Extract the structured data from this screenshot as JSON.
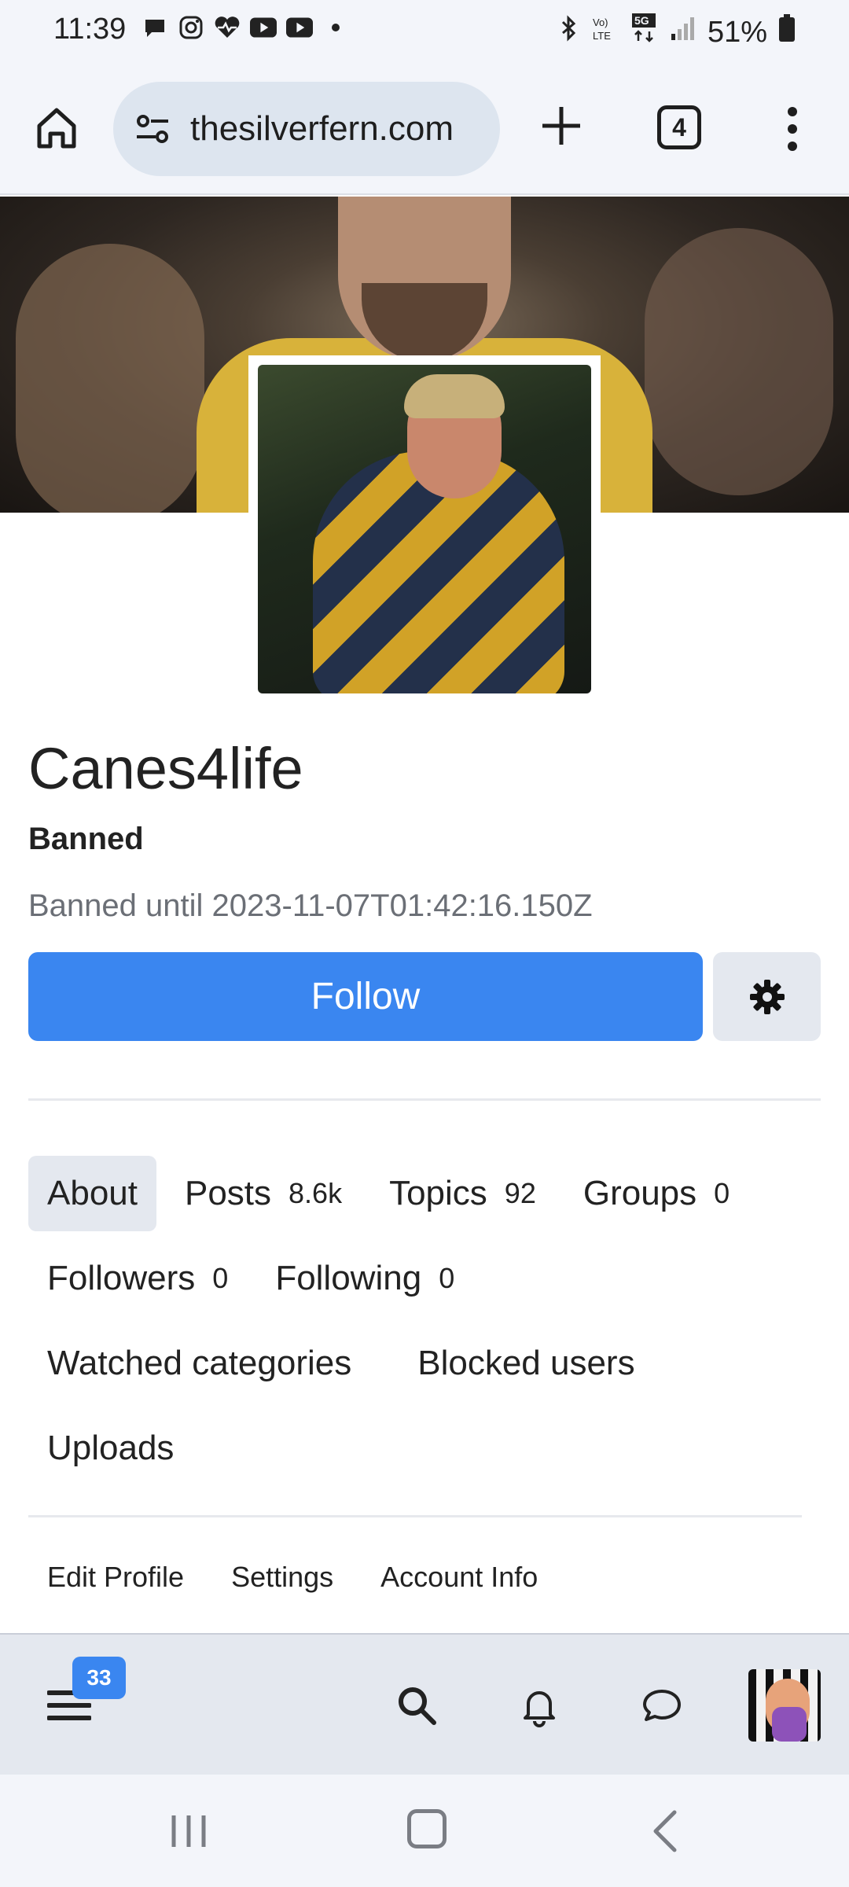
{
  "status_bar": {
    "time": "11:39",
    "battery": "51%",
    "left_icons": [
      "chat-bubble-icon",
      "instagram-icon",
      "health-icon",
      "youtube-icon",
      "youtube-icon",
      "dot-icon"
    ],
    "right_icons": [
      "bluetooth-icon",
      "volte-icon",
      "5g-icon",
      "signal-icon",
      "battery-icon"
    ]
  },
  "browser": {
    "url": "thesilverfern.com",
    "tab_count": "4"
  },
  "profile": {
    "username": "Canes4life",
    "status_label": "Banned",
    "banned_until": "Banned until 2023-11-07T01:42:16.150Z",
    "follow_label": "Follow"
  },
  "nav": {
    "about": "About",
    "posts": "Posts",
    "posts_count": "8.6k",
    "topics": "Topics",
    "topics_count": "92",
    "groups": "Groups",
    "groups_count": "0",
    "followers": "Followers",
    "followers_count": "0",
    "following": "Following",
    "following_count": "0",
    "watched_categories": "Watched categories",
    "blocked_users": "Blocked users",
    "uploads": "Uploads"
  },
  "sub_links": {
    "edit_profile": "Edit Profile",
    "settings": "Settings",
    "account_info": "Account Info"
  },
  "app_bar": {
    "notification_badge": "33"
  },
  "colors": {
    "primary": "#3a86f0",
    "chrome_bg": "#f3f5fa",
    "url_bg": "#dde5ef",
    "appbar_bg": "#e4e8ef"
  }
}
